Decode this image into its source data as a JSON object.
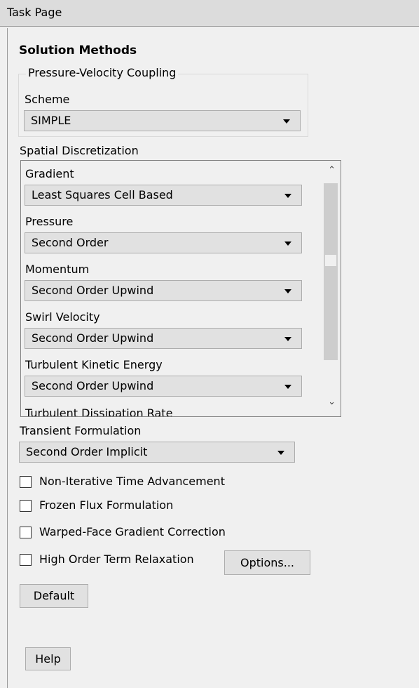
{
  "header": {
    "title": "Task Page"
  },
  "panel": {
    "title": "Solution Methods",
    "coupling": {
      "legend": "Pressure-Velocity Coupling",
      "scheme_label": "Scheme",
      "scheme_value": "SIMPLE"
    },
    "spatial": {
      "label": "Spatial Discretization",
      "items": [
        {
          "label": "Gradient",
          "value": "Least Squares Cell Based"
        },
        {
          "label": "Pressure",
          "value": "Second Order"
        },
        {
          "label": "Momentum",
          "value": "Second Order Upwind"
        },
        {
          "label": "Swirl Velocity",
          "value": "Second Order Upwind"
        },
        {
          "label": "Turbulent Kinetic Energy",
          "value": "Second Order Upwind"
        },
        {
          "label": "Turbulent Dissipation Rate"
        }
      ]
    },
    "transient": {
      "label": "Transient Formulation",
      "value": "Second Order Implicit"
    },
    "options": [
      {
        "label": "Non-Iterative Time Advancement",
        "checked": false
      },
      {
        "label": "Frozen Flux Formulation",
        "checked": false
      },
      {
        "label": "Warped-Face Gradient Correction",
        "checked": false
      },
      {
        "label": "High Order Term Relaxation",
        "checked": false
      }
    ],
    "options_button": "Options...",
    "default_button": "Default",
    "help_button": "Help"
  }
}
